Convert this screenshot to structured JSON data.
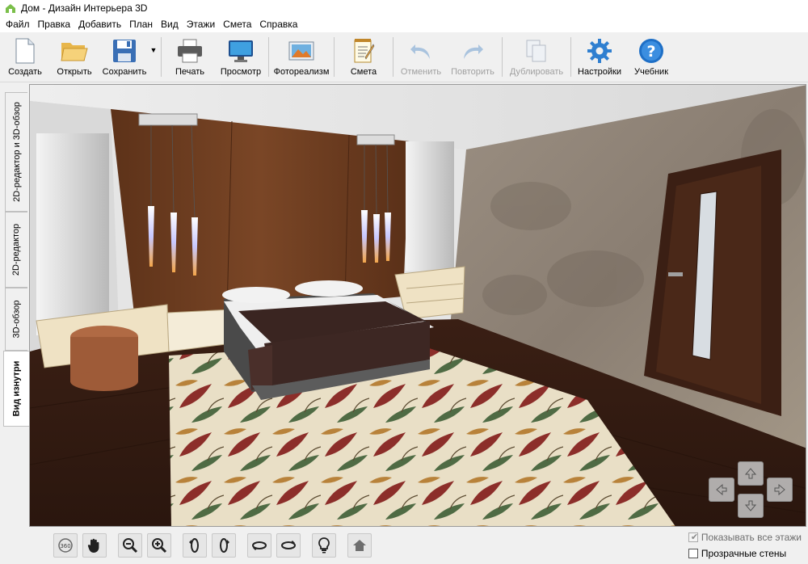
{
  "window": {
    "title": "Дом - Дизайн Интерьера 3D"
  },
  "menu": [
    "Файл",
    "Правка",
    "Добавить",
    "План",
    "Вид",
    "Этажи",
    "Смета",
    "Справка"
  ],
  "toolbar": {
    "create": "Создать",
    "open": "Открыть",
    "save": "Сохранить",
    "print": "Печать",
    "preview": "Просмотр",
    "photorealism": "Фотореализм",
    "estimate": "Смета",
    "undo": "Отменить",
    "redo": "Повторить",
    "duplicate": "Дублировать",
    "settings": "Настройки",
    "tutorial": "Учебник"
  },
  "side_tabs": [
    "2D-редактор и 3D-обзор",
    "2D-редактор",
    "3D-обзор",
    "Вид изнутри"
  ],
  "active_side_tab": "Вид изнутри",
  "bottom_tools": [
    "rotate-360-icon",
    "hand-pan-icon",
    "zoom-out-icon",
    "zoom-in-icon",
    "orbit-left-icon",
    "orbit-right-icon",
    "tilt-down-icon",
    "tilt-up-icon",
    "light-bulb-icon",
    "home-icon"
  ],
  "options": {
    "show_all_floors": "Показывать все этажи",
    "show_all_floors_checked": true,
    "show_all_floors_enabled": false,
    "transparent_walls": "Прозрачные стены",
    "transparent_walls_checked": false
  },
  "scene": {
    "room": "bedroom interior 3D view"
  },
  "colors": {
    "accent": "#1e6fc6",
    "wall_panel": "#6b3a1e",
    "floor": "#3a2014",
    "door": "#3b1f14"
  }
}
